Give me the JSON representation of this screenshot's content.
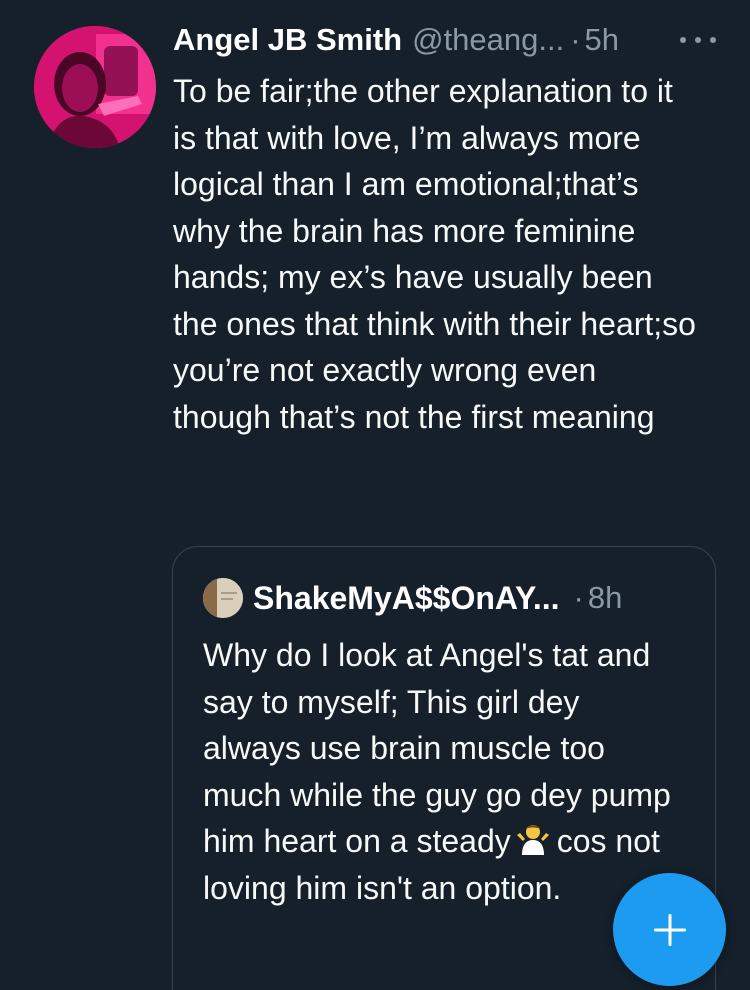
{
  "tweet": {
    "author_name": "Angel JB Smith",
    "author_handle": "@theang...",
    "separator": "·",
    "timestamp": "5h",
    "more_icon": "more-horizontal-icon",
    "avatar_color": "#e0157a",
    "text": "To be fair;the other explanation to it is that with love, I’m always more logical than I am emotional;that’s why the brain has more feminine hands; my ex’s have usually been the ones that think with their heart;so you’re not exactly wrong even though that’s not the first meaning"
  },
  "quoted_tweet": {
    "author_name": "ShakeMyA$$OnAY...",
    "separator": "·",
    "timestamp": "8h",
    "text_before_emoji": "Why do I look at Angel's tat and say to myself; This girl dey always use brain muscle too much while the guy go dey pump him heart on a steady",
    "emoji": "person-shrugging-emoji",
    "text_after_emoji": "cos not loving him isn't an option."
  },
  "compose_button": {
    "icon": "plus-icon",
    "color": "#1d9bf0"
  },
  "theme": {
    "background": "#15202b",
    "secondary_text": "#8b98a5",
    "border": "#38444d"
  }
}
